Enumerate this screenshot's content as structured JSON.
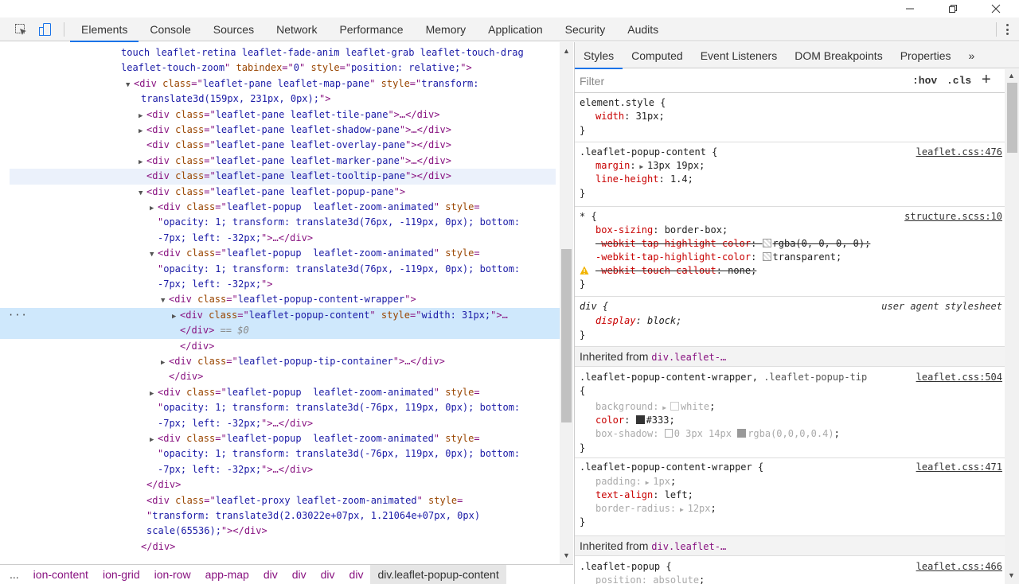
{
  "toolbar": {
    "tabs": [
      "Elements",
      "Console",
      "Sources",
      "Network",
      "Performance",
      "Memory",
      "Application",
      "Security",
      "Audits"
    ],
    "active_tab": "Elements"
  },
  "elements": {
    "lines": [
      {
        "indent": 0,
        "parts": [
          [
            "val",
            "touch leaflet-retina leaflet-fade-anim leaflet-grab leaflet-touch-drag"
          ]
        ]
      },
      {
        "indent": 0,
        "parts": [
          [
            "val",
            "leaflet-touch-zoom"
          ],
          [
            "tag",
            "\" "
          ],
          [
            "attr",
            "tabindex"
          ],
          [
            "tag",
            "=\""
          ],
          [
            "val",
            "0"
          ],
          [
            "tag",
            "\" "
          ],
          [
            "attr",
            "style"
          ],
          [
            "tag",
            "=\""
          ],
          [
            "val",
            "position: relative;"
          ],
          [
            "tag",
            "\">"
          ]
        ]
      },
      {
        "indent": 1,
        "tri": "▼",
        "parts": [
          [
            "tag",
            "<div "
          ],
          [
            "attr",
            "class"
          ],
          [
            "tag",
            "=\""
          ],
          [
            "val",
            "leaflet-pane leaflet-map-pane"
          ],
          [
            "tag",
            "\" "
          ],
          [
            "attr",
            "style"
          ],
          [
            "tag",
            "=\""
          ],
          [
            "val",
            "transform:"
          ]
        ]
      },
      {
        "indent": 1,
        "parts": [
          [
            "val",
            "translate3d(159px, 231px, 0px);"
          ],
          [
            "tag",
            "\">"
          ]
        ]
      },
      {
        "indent": 2,
        "tri": "▶",
        "parts": [
          [
            "tag",
            "<div "
          ],
          [
            "attr",
            "class"
          ],
          [
            "tag",
            "=\""
          ],
          [
            "val",
            "leaflet-pane leaflet-tile-pane"
          ],
          [
            "tag",
            "\">…</div>"
          ]
        ]
      },
      {
        "indent": 2,
        "tri": "▶",
        "parts": [
          [
            "tag",
            "<div "
          ],
          [
            "attr",
            "class"
          ],
          [
            "tag",
            "=\""
          ],
          [
            "val",
            "leaflet-pane leaflet-shadow-pane"
          ],
          [
            "tag",
            "\">…</div>"
          ]
        ]
      },
      {
        "indent": 2,
        "parts": [
          [
            "tag",
            "<div "
          ],
          [
            "attr",
            "class"
          ],
          [
            "tag",
            "=\""
          ],
          [
            "val",
            "leaflet-pane leaflet-overlay-pane"
          ],
          [
            "tag",
            "\"></div>"
          ]
        ]
      },
      {
        "indent": 2,
        "tri": "▶",
        "parts": [
          [
            "tag",
            "<div "
          ],
          [
            "attr",
            "class"
          ],
          [
            "tag",
            "=\""
          ],
          [
            "val",
            "leaflet-pane leaflet-marker-pane"
          ],
          [
            "tag",
            "\">…</div>"
          ]
        ]
      },
      {
        "indent": 2,
        "hover": true,
        "parts": [
          [
            "tag",
            "<div "
          ],
          [
            "attr",
            "class"
          ],
          [
            "tag",
            "=\""
          ],
          [
            "val",
            "leaflet-pane leaflet-tooltip-pane"
          ],
          [
            "tag",
            "\"></div>"
          ]
        ]
      },
      {
        "indent": 2,
        "tri": "▼",
        "parts": [
          [
            "tag",
            "<div "
          ],
          [
            "attr",
            "class"
          ],
          [
            "tag",
            "=\""
          ],
          [
            "val",
            "leaflet-pane leaflet-popup-pane"
          ],
          [
            "tag",
            "\">"
          ]
        ]
      },
      {
        "indent": 3,
        "tri": "▶",
        "parts": [
          [
            "tag",
            "<div "
          ],
          [
            "attr",
            "class"
          ],
          [
            "tag",
            "=\""
          ],
          [
            "val",
            "leaflet-popup  leaflet-zoom-animated"
          ],
          [
            "tag",
            "\" "
          ],
          [
            "attr",
            "style"
          ],
          [
            "tag",
            "="
          ]
        ]
      },
      {
        "indent": 3,
        "parts": [
          [
            "tag",
            "\""
          ],
          [
            "val",
            "opacity: 1; transform: translate3d(76px, -119px, 0px); bottom:"
          ]
        ]
      },
      {
        "indent": 3,
        "parts": [
          [
            "val",
            "-7px; left: -32px;"
          ],
          [
            "tag",
            "\">…</div>"
          ]
        ]
      },
      {
        "indent": 3,
        "tri": "▼",
        "parts": [
          [
            "tag",
            "<div "
          ],
          [
            "attr",
            "class"
          ],
          [
            "tag",
            "=\""
          ],
          [
            "val",
            "leaflet-popup  leaflet-zoom-animated"
          ],
          [
            "tag",
            "\" "
          ],
          [
            "attr",
            "style"
          ],
          [
            "tag",
            "="
          ]
        ]
      },
      {
        "indent": 3,
        "parts": [
          [
            "tag",
            "\""
          ],
          [
            "val",
            "opacity: 1; transform: translate3d(76px, -119px, 0px); bottom:"
          ]
        ]
      },
      {
        "indent": 3,
        "parts": [
          [
            "val",
            "-7px; left: -32px;"
          ],
          [
            "tag",
            "\">"
          ]
        ]
      },
      {
        "indent": 4,
        "tri": "▼",
        "parts": [
          [
            "tag",
            "<div "
          ],
          [
            "attr",
            "class"
          ],
          [
            "tag",
            "=\""
          ],
          [
            "val",
            "leaflet-popup-content-wrapper"
          ],
          [
            "tag",
            "\">"
          ]
        ]
      },
      {
        "indent": 5,
        "tri": "▶",
        "selected": true,
        "dots": "···",
        "parts": [
          [
            "tag",
            "<div "
          ],
          [
            "attr",
            "class"
          ],
          [
            "tag",
            "=\""
          ],
          [
            "val",
            "leaflet-popup-content"
          ],
          [
            "tag",
            "\" "
          ],
          [
            "attr",
            "style"
          ],
          [
            "tag",
            "=\""
          ],
          [
            "val",
            "width: 31px;"
          ],
          [
            "tag",
            "\">…"
          ]
        ]
      },
      {
        "indent": 5,
        "selected": true,
        "parts": [
          [
            "tag",
            "</div>"
          ],
          [
            "dollar",
            " == $0"
          ]
        ]
      },
      {
        "indent": 5,
        "parts": [
          [
            "tag",
            "</div>"
          ]
        ]
      },
      {
        "indent": 4,
        "tri": "▶",
        "parts": [
          [
            "tag",
            "<div "
          ],
          [
            "attr",
            "class"
          ],
          [
            "tag",
            "=\""
          ],
          [
            "val",
            "leaflet-popup-tip-container"
          ],
          [
            "tag",
            "\">…</div>"
          ]
        ]
      },
      {
        "indent": 4,
        "parts": [
          [
            "tag",
            "</div>"
          ]
        ]
      },
      {
        "indent": 3,
        "tri": "▶",
        "parts": [
          [
            "tag",
            "<div "
          ],
          [
            "attr",
            "class"
          ],
          [
            "tag",
            "=\""
          ],
          [
            "val",
            "leaflet-popup  leaflet-zoom-animated"
          ],
          [
            "tag",
            "\" "
          ],
          [
            "attr",
            "style"
          ],
          [
            "tag",
            "="
          ]
        ]
      },
      {
        "indent": 3,
        "parts": [
          [
            "tag",
            "\""
          ],
          [
            "val",
            "opacity: 1; transform: translate3d(-76px, 119px, 0px); bottom:"
          ]
        ]
      },
      {
        "indent": 3,
        "parts": [
          [
            "val",
            "-7px; left: -32px;"
          ],
          [
            "tag",
            "\">…</div>"
          ]
        ]
      },
      {
        "indent": 3,
        "tri": "▶",
        "parts": [
          [
            "tag",
            "<div "
          ],
          [
            "attr",
            "class"
          ],
          [
            "tag",
            "=\""
          ],
          [
            "val",
            "leaflet-popup  leaflet-zoom-animated"
          ],
          [
            "tag",
            "\" "
          ],
          [
            "attr",
            "style"
          ],
          [
            "tag",
            "="
          ]
        ]
      },
      {
        "indent": 3,
        "parts": [
          [
            "tag",
            "\""
          ],
          [
            "val",
            "opacity: 1; transform: translate3d(-76px, 119px, 0px); bottom:"
          ]
        ]
      },
      {
        "indent": 3,
        "parts": [
          [
            "val",
            "-7px; left: -32px;"
          ],
          [
            "tag",
            "\">…</div>"
          ]
        ]
      },
      {
        "indent": 2,
        "parts": [
          [
            "tag",
            "</div>"
          ]
        ]
      },
      {
        "indent": 2,
        "parts": [
          [
            "tag",
            "<div "
          ],
          [
            "attr",
            "class"
          ],
          [
            "tag",
            "=\""
          ],
          [
            "val",
            "leaflet-proxy leaflet-zoom-animated"
          ],
          [
            "tag",
            "\" "
          ],
          [
            "attr",
            "style"
          ],
          [
            "tag",
            "="
          ]
        ]
      },
      {
        "indent": 2,
        "parts": [
          [
            "tag",
            "\""
          ],
          [
            "val",
            "transform: translate3d(2.03022e+07px, 1.21064e+07px, 0px)"
          ]
        ]
      },
      {
        "indent": 2,
        "parts": [
          [
            "val",
            "scale(65536);"
          ],
          [
            "tag",
            "\"></div>"
          ]
        ]
      },
      {
        "indent": 1,
        "parts": [
          [
            "tag",
            "</div>"
          ]
        ]
      }
    ]
  },
  "breadcrumbs": [
    "...",
    "ion-content",
    "ion-grid",
    "ion-row",
    "app-map",
    "div",
    "div",
    "div",
    "div",
    "div.leaflet-popup-content"
  ],
  "styles": {
    "subtabs": [
      "Styles",
      "Computed",
      "Event Listeners",
      "DOM Breakpoints",
      "Properties",
      "»"
    ],
    "filter_placeholder": "Filter",
    "hov": ":hov",
    "cls": ".cls",
    "plus": "+",
    "inherited_label": "Inherited from",
    "inherited_ref": "div.leaflet-…"
  }
}
